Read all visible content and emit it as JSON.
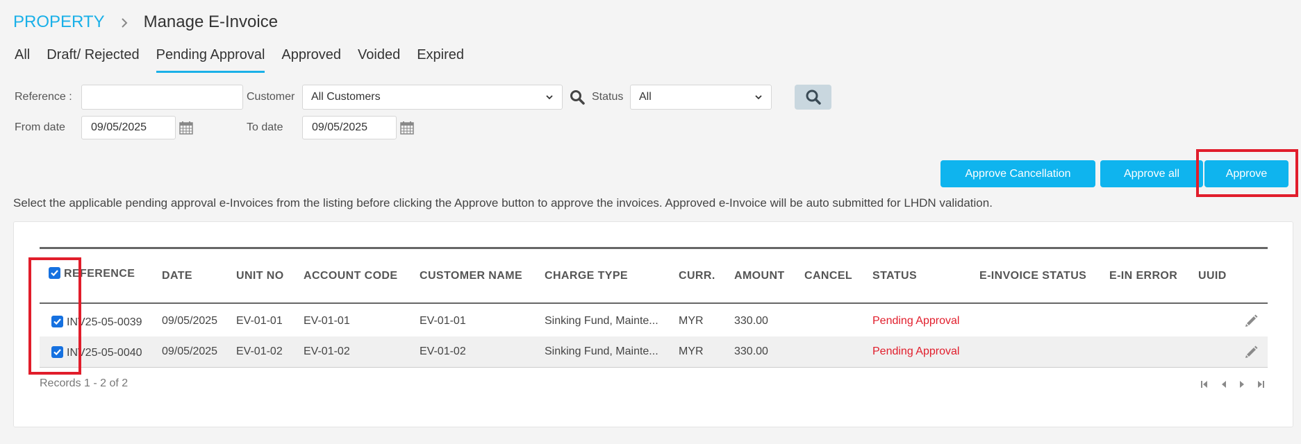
{
  "breadcrumb": {
    "root": "PROPERTY",
    "page": "Manage E-Invoice"
  },
  "tabs": [
    {
      "label": "All",
      "active": false
    },
    {
      "label": "Draft/ Rejected",
      "active": false
    },
    {
      "label": "Pending Approval",
      "active": true
    },
    {
      "label": "Approved",
      "active": false
    },
    {
      "label": "Voided",
      "active": false
    },
    {
      "label": "Expired",
      "active": false
    }
  ],
  "filters": {
    "reference_label": "Reference :",
    "reference_value": "",
    "customer_label": "Customer",
    "customer_value": "All Customers",
    "status_label": "Status",
    "status_value": "All",
    "from_label": "From date",
    "from_value": "09/05/2025",
    "to_label": "To date",
    "to_value": "09/05/2025"
  },
  "actions": {
    "approve_cancellation": "Approve Cancellation",
    "approve_all": "Approve all",
    "approve": "Approve"
  },
  "help_text": "Select the applicable pending approval e-Invoices from the listing before clicking the Approve button to approve the invoices. Approved e-Invoice will be auto submitted for LHDN validation.",
  "table": {
    "headers": {
      "reference": "REFERENCE",
      "date": "DATE",
      "unit_no": "UNIT NO",
      "account_code": "ACCOUNT CODE",
      "customer_name": "CUSTOMER NAME",
      "charge_type": "CHARGE TYPE",
      "curr": "CURR.",
      "amount": "AMOUNT",
      "cancel": "CANCEL",
      "status": "STATUS",
      "einvoice_status": "E-INVOICE STATUS",
      "ein_error": "E-IN ERROR",
      "uuid": "UUID"
    },
    "rows": [
      {
        "reference": "INV25-05-0039",
        "date": "09/05/2025",
        "unit_no": "EV-01-01",
        "account_code": "EV-01-01",
        "customer_name": "EV-01-01",
        "charge_type": "Sinking Fund, Mainte...",
        "curr": "MYR",
        "amount": "330.00",
        "cancel": "",
        "status": "Pending Approval",
        "einvoice_status": "",
        "ein_error": "",
        "uuid": "",
        "checked": true
      },
      {
        "reference": "INV25-05-0040",
        "date": "09/05/2025",
        "unit_no": "EV-01-02",
        "account_code": "EV-01-02",
        "customer_name": "EV-01-02",
        "charge_type": "Sinking Fund, Mainte...",
        "curr": "MYR",
        "amount": "330.00",
        "cancel": "",
        "status": "Pending Approval",
        "einvoice_status": "",
        "ein_error": "",
        "uuid": "",
        "checked": true
      }
    ],
    "records_text": "Records 1 - 2 of 2"
  },
  "colors": {
    "accent": "#1ab0e8",
    "button": "#0fb4ee",
    "status_pending": "#e11d2b",
    "highlight": "#e11d2b"
  },
  "icons": [
    "chevron-right-icon",
    "search-icon",
    "chevron-down-icon",
    "calendar-icon",
    "checkbox-icon",
    "pencil-icon",
    "first-page-icon",
    "prev-page-icon",
    "next-page-icon",
    "last-page-icon"
  ]
}
